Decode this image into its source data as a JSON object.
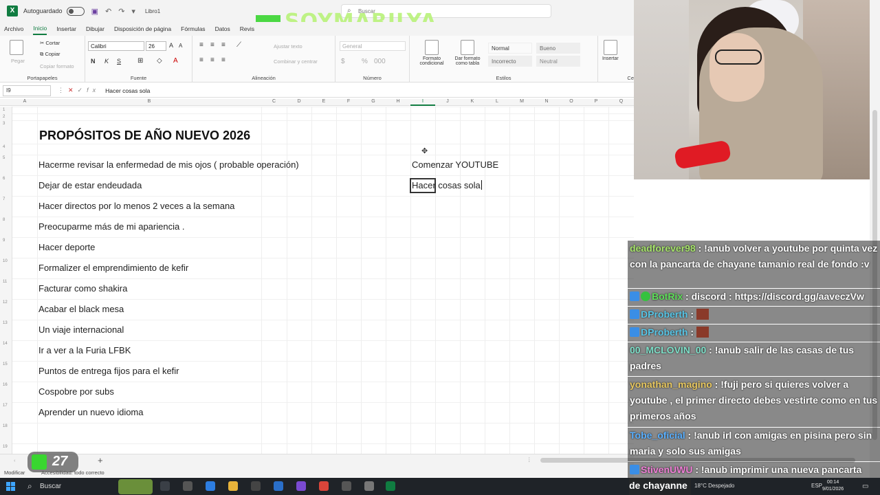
{
  "titlebar": {
    "autosave_label": "Autoguardado",
    "filename": "Libro1",
    "search_placeholder": "Buscar",
    "watermark": "SOYMARILYA"
  },
  "tabs": [
    "Archivo",
    "Inicio",
    "Insertar",
    "Dibujar",
    "Disposición de página",
    "Fórmulas",
    "Datos",
    "Revis"
  ],
  "active_tab": "Inicio",
  "ribbon": {
    "clipboard": {
      "paste": "Pegar",
      "cut": "Cortar",
      "copy": "Copiar",
      "format_painter": "Copiar formato",
      "label": "Portapapeles"
    },
    "font": {
      "name": "Calibri",
      "size": "26",
      "label": "Fuente"
    },
    "alignment": {
      "wrap": "Ajustar texto",
      "merge": "Combinar y centrar",
      "label": "Alineación"
    },
    "number": {
      "format": "General",
      "label": "Número"
    },
    "styles": {
      "conditional": "Formato condicional",
      "table": "Dar formato como tabla",
      "normal": "Normal",
      "bueno": "Bueno",
      "incorrecto": "Incorrecto",
      "neutral": "Neutral",
      "label": "Estilos"
    },
    "cells": {
      "insert": "Insertar",
      "label": "Ce"
    }
  },
  "formula_bar": {
    "name_box": "I9",
    "content": "Hacer cosas sola"
  },
  "columns": [
    "A",
    "B",
    "C",
    "D",
    "E",
    "F",
    "G",
    "H",
    "I",
    "J",
    "K",
    "L",
    "M",
    "N",
    "O",
    "P",
    "Q"
  ],
  "selected_column": "I",
  "sheet": {
    "title": "PROPÓSITOS DE AÑO NUEVO 2026",
    "items": [
      "Hacerme revisar la enfermedad de mis ojos ( probable operación)",
      "Dejar de estar endeudada",
      "Hacer directos por lo menos  2 veces a la semana",
      "Preocuparme más de mi apariencia .",
      "Hacer deporte",
      "Formalizer el emprendimiento de kefir",
      "Facturar como shakira",
      "Acabar el black mesa",
      "Un viaje internacional",
      "Ir a ver a la Furia LFBK",
      "Puntos de entrega fijos para el kefir",
      "Cospobre por subs",
      "Aprender un nuevo idioma"
    ],
    "col_i_items": [
      "Comenzar YOUTUBE",
      "Hacer cosas sola"
    ]
  },
  "status": {
    "mode": "Modificar",
    "accessibility": "Accesibilidad: todo correcto",
    "badge_number": "27"
  },
  "chat": [
    {
      "user": "deadforever98",
      "text": " : !anub volver a youtube por quinta vez con la pancarta de chayane tamanio real de fondo :v",
      "color": "#a6e36b"
    },
    {
      "user": "BotRix",
      "text": " : discord : https://discord.gg/aaveczVw",
      "color": "#5fe05a"
    },
    {
      "user": "DProberth",
      "text": " :",
      "color": "#58c7e8"
    },
    {
      "user": "DProberth",
      "text": " :",
      "color": "#58c7e8"
    },
    {
      "user": "00_MCLOVIN_00",
      "text": " : !anub salir de las casas de tus padres",
      "color": "#7fe0c9"
    },
    {
      "user": "yonathan_magino",
      "text": " : !fuji pero si quieres volver a youtube , el primer directo debes vestirte como en tus primeros años",
      "color": "#e8c860"
    },
    {
      "user": "Tobe_oficial",
      "text": " : !anub irl con amigas en pisina pero sin maria y solo sus amigas",
      "color": "#5ab0ff"
    },
    {
      "user": "StivenUWU",
      "text": " : !anub imprimir una nueva pancarta",
      "color": "#f07fd6"
    }
  ],
  "taskbar": {
    "search": "Buscar",
    "overlay_text": "de chayanne",
    "weather": "18°C  Despejado",
    "lang": "ESP",
    "time": "00:14",
    "date": "9/01/2026"
  }
}
